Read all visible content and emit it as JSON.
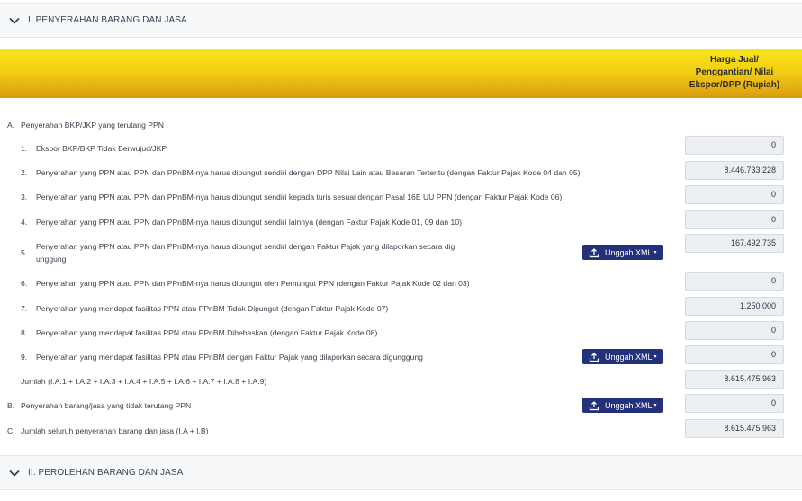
{
  "sections": {
    "s1_title": "I. PENYERAHAN BARANG DAN JASA",
    "s2_title": "II. PEROLEHAN BARANG DAN JASA"
  },
  "column_header": {
    "l1": "Harga Jual/",
    "l2": "Penggantian/ Nilai",
    "l3": "Ekspor/DPP (Rupiah)"
  },
  "group_a": {
    "num": "A.",
    "label": "Penyerahan BKP/JKP yang terutang PPN"
  },
  "rows": [
    {
      "num": "1.",
      "label": "Ekspor BKP/BKP Tidak Berwujud/JKP",
      "value": "0"
    },
    {
      "num": "2.",
      "label": "Penyerahan yang PPN atau PPN dan PPnBM-nya harus dipungut sendiri dengan DPP Nilai Lain atau Besaran Tertentu (dengan Faktur Pajak Kode 04 dan 05)",
      "value": "8.446.733.228"
    },
    {
      "num": "3.",
      "label": "Penyerahan yang PPN atau PPN dan PPnBM-nya harus dipungut sendiri kepada turis sesuai dengan Pasal 16E UU PPN (dengan Faktur Pajak Kode 06)",
      "value": "0"
    },
    {
      "num": "4.",
      "label": "Penyerahan yang PPN atau PPN dan PPnBM-nya harus dipungut sendiri lainnya (dengan Faktur Pajak Kode 01, 09 dan 10)",
      "value": "0"
    },
    {
      "num": "5.",
      "label": "Penyerahan yang PPN atau PPN dan PPnBM-nya harus dipungut sendiri dengan Faktur Pajak yang dilaporkan secara dig",
      "label2": "unggung",
      "value": "167.492.735"
    },
    {
      "num": "6.",
      "label": "Penyerahan yang PPN atau PPN dan PPnBM-nya harus dipungut oleh Pemungut PPN (dengan Faktur Pajak Kode 02 dan 03)",
      "value": "0"
    },
    {
      "num": "7.",
      "label": "Penyerahan yang mendapat fasilitas PPN atau PPnBM Tidak Dipungut (dengan Faktur Pajak Kode 07)",
      "value": "1.250.000"
    },
    {
      "num": "8.",
      "label": "Penyerahan yang mendapat fasilitas PPN atau PPnBM Dibebaskan (dengan Faktur Pajak Kode 08)",
      "value": "0"
    },
    {
      "num": "9.",
      "label": "Penyerahan yang mendapat fasilitas PPN atau PPnBM dengan Faktur Pajak yang dilaporkan secara digunggung",
      "value": "0"
    }
  ],
  "jumlah": {
    "label": "Jumlah (I.A.1 + I.A.2 + I.A.3 + I.A.4 + I.A.5 + I.A.6 + I.A.7 + I.A.8 + I.A.9)",
    "value": "8.615.475.963"
  },
  "group_b": {
    "num": "B.",
    "label": "Penyerahan barang/jasa yang tidak terutang PPN",
    "value": "0"
  },
  "group_c": {
    "num": "C.",
    "label": "Jumlah seluruh penyerahan barang dan jasa (I.A + I.B)",
    "value": "8.615.475.963"
  },
  "upload_button_label": "Unggah XML",
  "icons": {
    "chevron": "chevron-down-icon",
    "upload": "upload-icon"
  },
  "colors": {
    "accent_yellow": "#f3cf14",
    "button_navy": "#23307a"
  }
}
